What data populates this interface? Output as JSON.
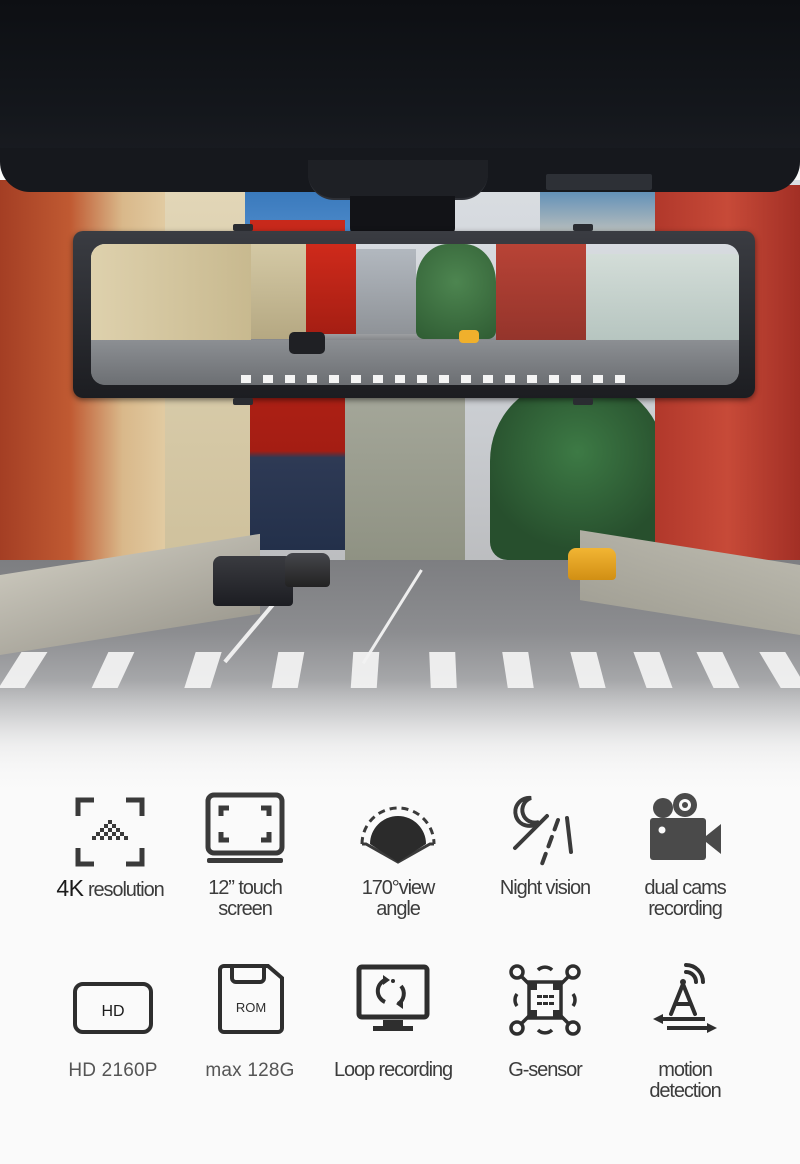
{
  "product": {
    "scene": "rear-view mirror dash cam mounted on car headliner over city street",
    "mirror_screen": "live street view"
  },
  "features": {
    "row1": [
      {
        "id": "4k",
        "icon": "4k-resolution-icon",
        "label_strong": "4K",
        "label": "resolution"
      },
      {
        "id": "touch",
        "icon": "touch-screen-icon",
        "line1": "12” touch",
        "line2": "screen"
      },
      {
        "id": "angle",
        "icon": "view-angle-icon",
        "line1": "170°view",
        "line2": "angle"
      },
      {
        "id": "night",
        "icon": "night-vision-icon",
        "line1": "Night vision"
      },
      {
        "id": "dual",
        "icon": "video-camera-icon",
        "line1": "dual cams",
        "line2": "recording"
      }
    ],
    "row2": [
      {
        "id": "hd",
        "icon": "hd-badge-icon",
        "icon_text": "HD",
        "line1": "HD 2160P"
      },
      {
        "id": "rom",
        "icon": "sd-card-icon",
        "icon_text": "ROM",
        "line1": "max 128G"
      },
      {
        "id": "loop",
        "icon": "loop-recording-icon",
        "line1": "Loop recording"
      },
      {
        "id": "gsensor",
        "icon": "g-sensor-icon",
        "line1": "G-sensor"
      },
      {
        "id": "motion",
        "icon": "motion-detection-icon",
        "line1": "motion",
        "line2": "detection"
      }
    ]
  },
  "colors": {
    "icon": "#3a3a3a",
    "text": "#3c3c3c",
    "background": "#fafafa"
  }
}
